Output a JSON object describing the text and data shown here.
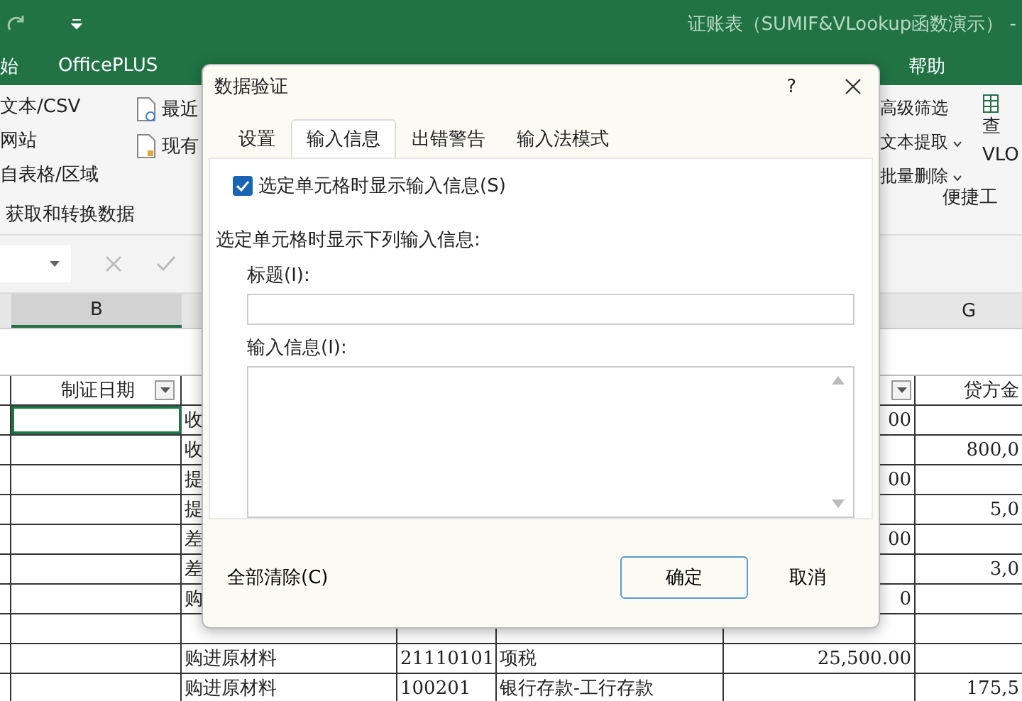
{
  "window": {
    "title": "证账表（SUMIF&VLookup函数演示）  -"
  },
  "ribbon_tabs": [
    "始",
    "OfficePLUS",
    "帮助"
  ],
  "ribbon": {
    "get_data": [
      "文本/CSV",
      "网站",
      "自表格/区域"
    ],
    "get_data_group": "获取和转换数据",
    "connections": [
      "最近",
      "现有"
    ],
    "tools": [
      "高级筛选",
      "文本提取",
      "批量删除"
    ],
    "lookup": [
      "查",
      "VLO"
    ],
    "tools_group": "便捷工"
  },
  "column_headers": {
    "left": "B",
    "right": "G"
  },
  "header_row": {
    "b": "制证日期",
    "g": "贷方金"
  },
  "rows": [
    {
      "c": "收",
      "d": "",
      "e": "",
      "f": "00",
      "g": ""
    },
    {
      "c": "收",
      "d": "",
      "e": "",
      "f": "",
      "g": "800,0"
    },
    {
      "c": "提",
      "d": "",
      "e": "",
      "f": "00",
      "g": ""
    },
    {
      "c": "提",
      "d": "",
      "e": "",
      "f": "",
      "g": "5,0"
    },
    {
      "c": "差",
      "d": "",
      "e": "",
      "f": "00",
      "g": ""
    },
    {
      "c": "差",
      "d": "",
      "e": "",
      "f": "",
      "g": "3,0"
    },
    {
      "c": "购",
      "d": "",
      "e": "",
      "f": "0",
      "g": ""
    },
    {
      "c": "",
      "d": "",
      "e": "",
      "f": "",
      "g": ""
    },
    {
      "c": "购进原材料",
      "d": "21110101",
      "e": "项税",
      "f": "25,500.00",
      "g": ""
    },
    {
      "c": "购进原材料",
      "d": "100201",
      "e": "银行存款-工行存款",
      "f": "",
      "g": "175,5"
    }
  ],
  "dialog": {
    "title": "数据验证",
    "help": "?",
    "tabs": [
      {
        "label": "设置",
        "selected": false
      },
      {
        "label": "输入信息",
        "selected": true
      },
      {
        "label": "出错警告",
        "selected": false
      },
      {
        "label": "输入法模式",
        "selected": false
      }
    ],
    "show_checkbox": {
      "label": "选定单元格时显示输入信息(S)",
      "checked": true
    },
    "section_label": "选定单元格时显示下列输入信息:",
    "title_field": {
      "label": "标题(I):"
    },
    "message_field": {
      "label": "输入信息(I):"
    },
    "clear_button": "全部清除(C)",
    "ok_button": "确定",
    "cancel_button": "取消"
  }
}
